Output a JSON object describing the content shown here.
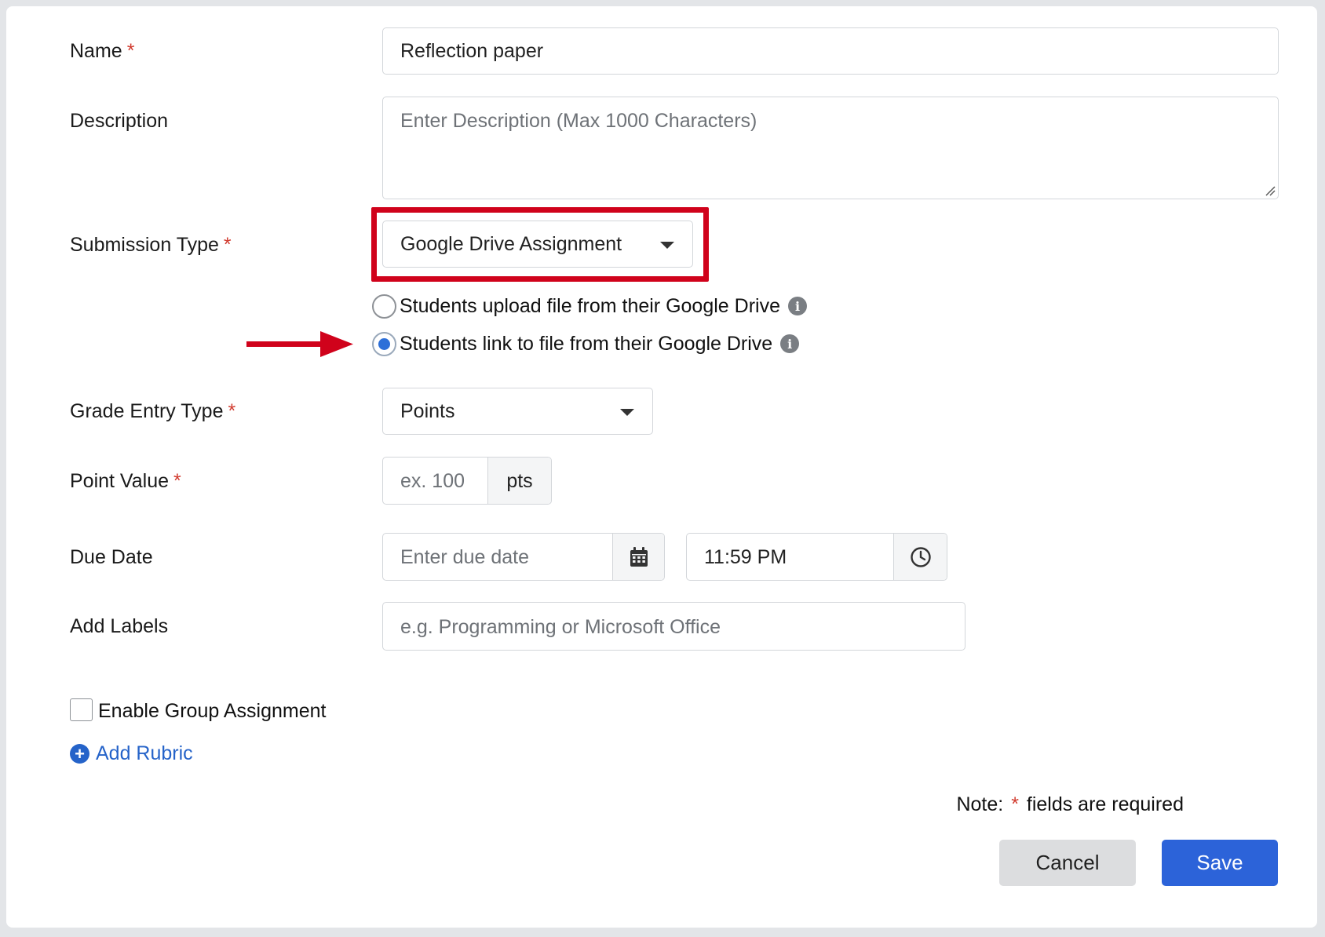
{
  "form": {
    "name": {
      "label": "Name",
      "required_mark": "*",
      "value": "Reflection paper"
    },
    "description": {
      "label": "Description",
      "placeholder": "Enter Description (Max 1000 Characters)"
    },
    "submission_type": {
      "label": "Submission Type",
      "required_mark": "*",
      "selected": "Google Drive Assignment",
      "options": [
        {
          "label": "Students upload file from their Google Drive",
          "checked": false
        },
        {
          "label": "Students link to file from their Google Drive",
          "checked": true
        }
      ]
    },
    "grade_entry_type": {
      "label": "Grade Entry Type",
      "required_mark": "*",
      "selected": "Points"
    },
    "point_value": {
      "label": "Point Value",
      "required_mark": "*",
      "placeholder": "ex. 100",
      "unit": "pts"
    },
    "due_date": {
      "label": "Due Date",
      "date_placeholder": "Enter due date",
      "time_value": "11:59 PM"
    },
    "labels": {
      "label": "Add Labels",
      "placeholder": "e.g. Programming or Microsoft Office"
    },
    "group_assignment": {
      "label": "Enable Group Assignment",
      "checked": false
    },
    "add_rubric": {
      "label": "Add Rubric"
    }
  },
  "footer": {
    "note_prefix": "Note:",
    "note_mark": "*",
    "note_suffix": "fields are required",
    "cancel_label": "Cancel",
    "save_label": "Save"
  },
  "colors": {
    "accent": "#2c63d9",
    "required": "#d13b2f",
    "annotation_red": "#d0021b",
    "link": "#2563c9"
  },
  "icons": {
    "select_caret": "chevron-down-icon",
    "calendar": "calendar-icon",
    "clock": "clock-icon",
    "info": "info-icon",
    "plus": "plus-circle-icon",
    "annotation_arrow": "arrow-right-icon"
  }
}
